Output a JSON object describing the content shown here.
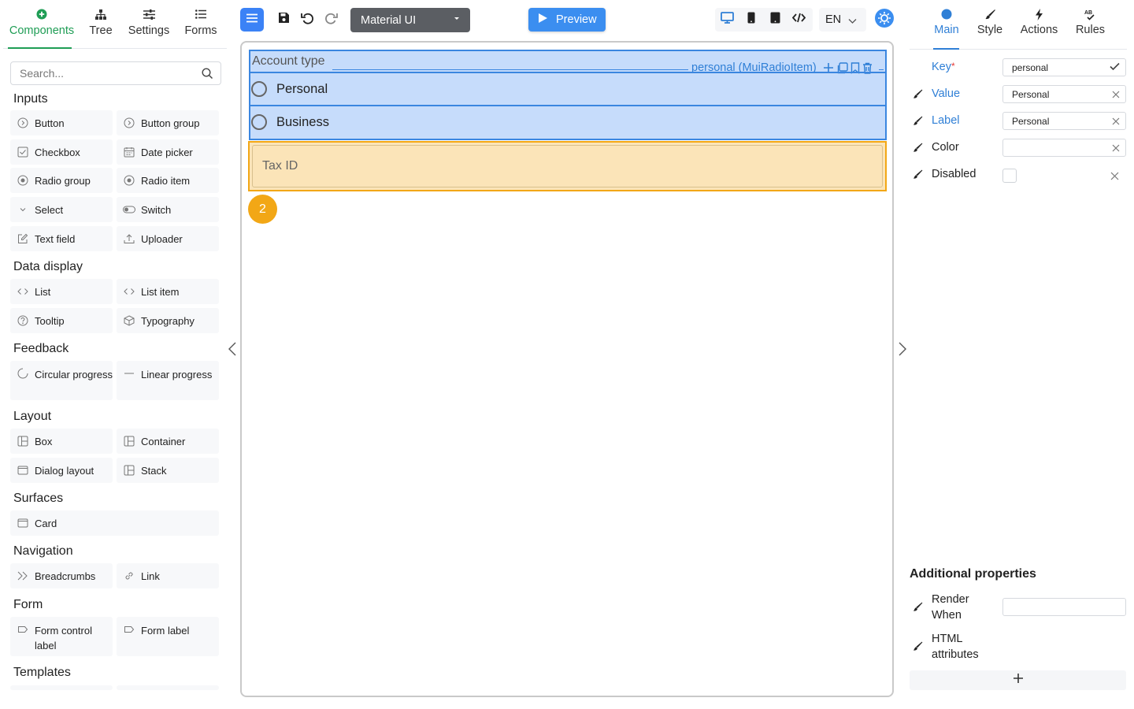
{
  "left_tabs": [
    {
      "label": "Components",
      "icon": "plus-circle-icon"
    },
    {
      "label": "Tree",
      "icon": "sitemap-icon"
    },
    {
      "label": "Settings",
      "icon": "sliders-icon"
    },
    {
      "label": "Forms",
      "icon": "list-icon"
    }
  ],
  "search": {
    "placeholder": "Search..."
  },
  "sections": {
    "inputs": "Inputs",
    "data_display": "Data display",
    "feedback": "Feedback",
    "layout": "Layout",
    "surfaces": "Surfaces",
    "navigation": "Navigation",
    "form": "Form",
    "templates": "Templates"
  },
  "components": {
    "button": "Button",
    "button_group": "Button group",
    "checkbox": "Checkbox",
    "date_picker": "Date picker",
    "radio_group": "Radio group",
    "radio_item": "Radio item",
    "select": "Select",
    "switch": "Switch",
    "text_field": "Text field",
    "uploader": "Uploader",
    "list": "List",
    "list_item": "List item",
    "tooltip": "Tooltip",
    "typography": "Typography",
    "circular_progress": "Circular progress",
    "linear_progress": "Linear progress",
    "box": "Box",
    "container": "Container",
    "dialog_layout": "Dialog layout",
    "stack": "Stack",
    "card": "Card",
    "breadcrumbs": "Breadcrumbs",
    "link": "Link",
    "form_control_label": "Form control label",
    "form_label": "Form label"
  },
  "toolbar": {
    "library": "Material UI",
    "preview": "Preview",
    "language": "EN"
  },
  "canvas": {
    "radio_group_label": "Account type",
    "selection_tag": "personal (MuiRadioItem)",
    "radio_items": [
      "Personal",
      "Business"
    ],
    "tax_field_label": "Tax ID",
    "badge_count": "2"
  },
  "right_tabs": [
    {
      "label": "Main",
      "icon": "circle-icon"
    },
    {
      "label": "Style",
      "icon": "brush-icon"
    },
    {
      "label": "Actions",
      "icon": "bolt-icon"
    },
    {
      "label": "Rules",
      "icon": "spellcheck-icon"
    }
  ],
  "properties": {
    "key": {
      "label": "Key",
      "required": "*",
      "value": "personal"
    },
    "value": {
      "label": "Value",
      "value": "Personal"
    },
    "label": {
      "label": "Label",
      "value": "Personal"
    },
    "color": {
      "label": "Color",
      "value": ""
    },
    "disabled": {
      "label": "Disabled",
      "checked": false
    }
  },
  "additional": {
    "title": "Additional properties",
    "render_when": "Render When",
    "html_attributes": "HTML attributes",
    "render_when_value": ""
  },
  "colors": {
    "accent_green": "#1f9d55",
    "accent_blue": "#2f7fd6",
    "selection_blue": "#3a86e0",
    "selection_fill": "#c6dcfb",
    "highlight_orange": "#f2a716",
    "highlight_fill": "#fbe4b8"
  }
}
